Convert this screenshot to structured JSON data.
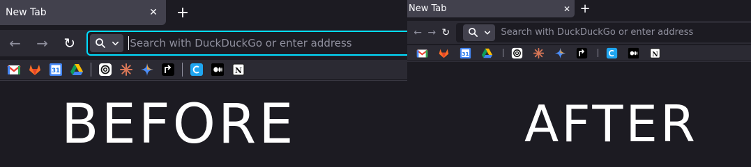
{
  "before": {
    "caption": "BEFORE",
    "tab": {
      "title": "New Tab",
      "close_glyph": "✕"
    },
    "new_tab_glyph": "+",
    "nav": {
      "back_glyph": "←",
      "forward_glyph": "→",
      "reload_glyph": "↻"
    },
    "url": {
      "placeholder": "Search with DuckDuckGo or enter address",
      "value": ""
    },
    "engine_icons": [
      "search-icon",
      "chevron-down-icon"
    ],
    "bookmarks": [
      "gmail-icon",
      "gitlab-icon",
      "google-calendar-icon",
      "google-drive-icon",
      "|",
      "openai-icon",
      "claude-icon",
      "gemini-icon",
      "perplexity-icon",
      "|",
      "cloudflare-icon",
      "medium-icon",
      "notion-icon"
    ]
  },
  "after": {
    "caption": "AFTER",
    "tab": {
      "title": "New Tab",
      "close_glyph": "✕"
    },
    "new_tab_glyph": "+",
    "nav": {
      "back_glyph": "←",
      "forward_glyph": "→",
      "reload_glyph": "↻"
    },
    "url": {
      "placeholder": "Search with DuckDuckGo or enter address",
      "value": ""
    },
    "engine_icons": [
      "search-icon",
      "chevron-down-icon"
    ],
    "bookmarks": [
      "gmail-icon",
      "gitlab-icon",
      "google-calendar-icon",
      "google-drive-icon",
      "|",
      "openai-icon",
      "claude-icon",
      "gemini-icon",
      "perplexity-icon",
      "|",
      "cloudflare-icon",
      "medium-icon",
      "notion-icon"
    ]
  },
  "colors": {
    "background": "#1c1b22",
    "toolbar": "#2b2a33",
    "tab": "#42414d",
    "focus_ring": "#00ddff",
    "placeholder": "#8f8f9d",
    "text": "#fbfbfe",
    "calendar_number": "31"
  }
}
